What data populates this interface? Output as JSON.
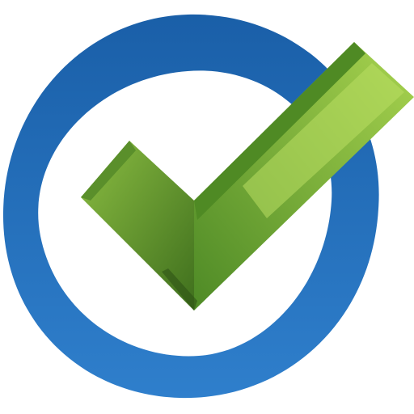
{
  "icon": {
    "name": "checkmark-in-circle-icon",
    "colors": {
      "ring_light": "#2f7fcc",
      "ring_dark": "#1a5fa8",
      "check_light": "#a8d34f",
      "check_mid": "#6ea634",
      "check_dark": "#3f6f1d",
      "check_shadow": "#2f5416",
      "background": "#ffffff"
    }
  }
}
